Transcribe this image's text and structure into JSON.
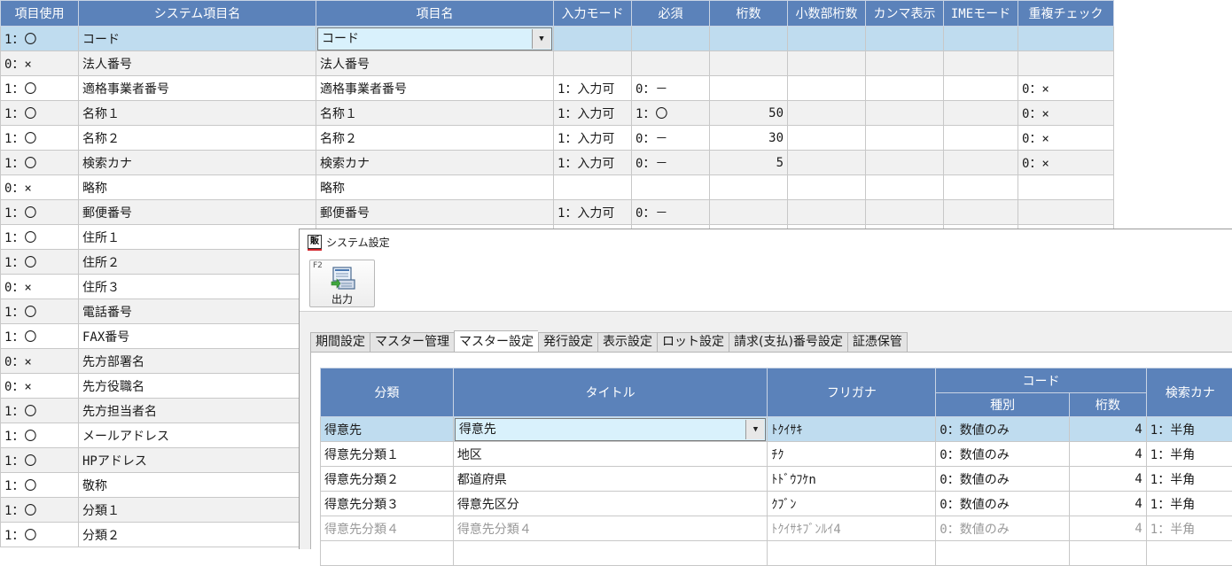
{
  "bg_grid": {
    "headers": [
      "項目使用",
      "システム項目名",
      "項目名",
      "入力モード",
      "必須",
      "桁数",
      "小数部桁数",
      "カンマ表示",
      "IMEモード",
      "重複チェック"
    ],
    "rows": [
      [
        "1：〇",
        "コード",
        "コード",
        "",
        "",
        "",
        "",
        "",
        "",
        ""
      ],
      [
        "0：×",
        "法人番号",
        "法人番号",
        "",
        "",
        "",
        "",
        "",
        "",
        ""
      ],
      [
        "1：〇",
        "適格事業者番号",
        "適格事業者番号",
        "1：入力可",
        "0：－",
        "",
        "",
        "",
        "",
        "0：×"
      ],
      [
        "1：〇",
        "名称１",
        "名称１",
        "1：入力可",
        "1：〇",
        "50",
        "",
        "",
        "",
        "0：×"
      ],
      [
        "1：〇",
        "名称２",
        "名称２",
        "1：入力可",
        "0：－",
        "30",
        "",
        "",
        "",
        "0：×"
      ],
      [
        "1：〇",
        "検索カナ",
        "検索カナ",
        "1：入力可",
        "0：－",
        "5",
        "",
        "",
        "",
        "0：×"
      ],
      [
        "0：×",
        "略称",
        "略称",
        "",
        "",
        "",
        "",
        "",
        "",
        ""
      ],
      [
        "1：〇",
        "郵便番号",
        "郵便番号",
        "1：入力可",
        "0：－",
        "",
        "",
        "",
        "",
        ""
      ],
      [
        "1：〇",
        "住所１",
        "",
        "",
        "",
        "",
        "",
        "",
        "",
        ""
      ],
      [
        "1：〇",
        "住所２",
        "",
        "",
        "",
        "",
        "",
        "",
        "",
        ""
      ],
      [
        "0：×",
        "住所３",
        "",
        "",
        "",
        "",
        "",
        "",
        "",
        ""
      ],
      [
        "1：〇",
        "電話番号",
        "",
        "",
        "",
        "",
        "",
        "",
        "",
        ""
      ],
      [
        "1：〇",
        "FAX番号",
        "",
        "",
        "",
        "",
        "",
        "",
        "",
        ""
      ],
      [
        "0：×",
        "先方部署名",
        "",
        "",
        "",
        "",
        "",
        "",
        "",
        ""
      ],
      [
        "0：×",
        "先方役職名",
        "",
        "",
        "",
        "",
        "",
        "",
        "",
        ""
      ],
      [
        "1：〇",
        "先方担当者名",
        "",
        "",
        "",
        "",
        "",
        "",
        "",
        ""
      ],
      [
        "1：〇",
        "メールアドレス",
        "",
        "",
        "",
        "",
        "",
        "",
        "",
        ""
      ],
      [
        "1：〇",
        "HPアドレス",
        "",
        "",
        "",
        "",
        "",
        "",
        "",
        ""
      ],
      [
        "1：〇",
        "敬称",
        "",
        "",
        "",
        "",
        "",
        "",
        "",
        ""
      ],
      [
        "1：〇",
        "分類１",
        "",
        "",
        "",
        "",
        "",
        "",
        "",
        ""
      ],
      [
        "1：〇",
        "分類２",
        "",
        "",
        "",
        "",
        "",
        "",
        "",
        ""
      ]
    ]
  },
  "dialog": {
    "title": "システム設定",
    "app_icon_char": "販",
    "toolbar": {
      "fkey": "F2",
      "output_label": "出力"
    },
    "tabs": [
      "期間設定",
      "マスター管理",
      "マスター設定",
      "発行設定",
      "表示設定",
      "ロット設定",
      "請求(支払)番号設定",
      "証憑保管"
    ],
    "active_tab": "マスター設定",
    "grid": {
      "headers": {
        "category": "分類",
        "title": "タイトル",
        "furigana": "フリガナ",
        "code_group": "コード",
        "code_type": "種別",
        "code_digits": "桁数",
        "search_kana": "検索カナ"
      },
      "rows": [
        [
          "得意先",
          "得意先",
          "ﾄｸｲｻｷ",
          "0：数値のみ",
          "4",
          "1：半角"
        ],
        [
          "得意先分類１",
          "地区",
          "ﾁｸ",
          "0：数値のみ",
          "4",
          "1：半角"
        ],
        [
          "得意先分類２",
          "都道府県",
          "ﾄﾄﾞｳﾌｹn",
          "0：数値のみ",
          "4",
          "1：半角"
        ],
        [
          "得意先分類３",
          "得意先区分",
          "ｸﾌﾞﾝ",
          "0：数値のみ",
          "4",
          "1：半角"
        ],
        [
          "得意先分類４",
          "得意先分類４",
          "ﾄｸｲｻｷﾌﾞﾝﾙｲ4",
          "0：数値のみ",
          "4",
          "1：半角"
        ],
        [
          "",
          "",
          "",
          "",
          "",
          ""
        ]
      ]
    }
  },
  "colors": {
    "header_bg": "#5b82ba",
    "selected_row": "#bfdcef",
    "combo_bg": "#d9f1fc"
  }
}
